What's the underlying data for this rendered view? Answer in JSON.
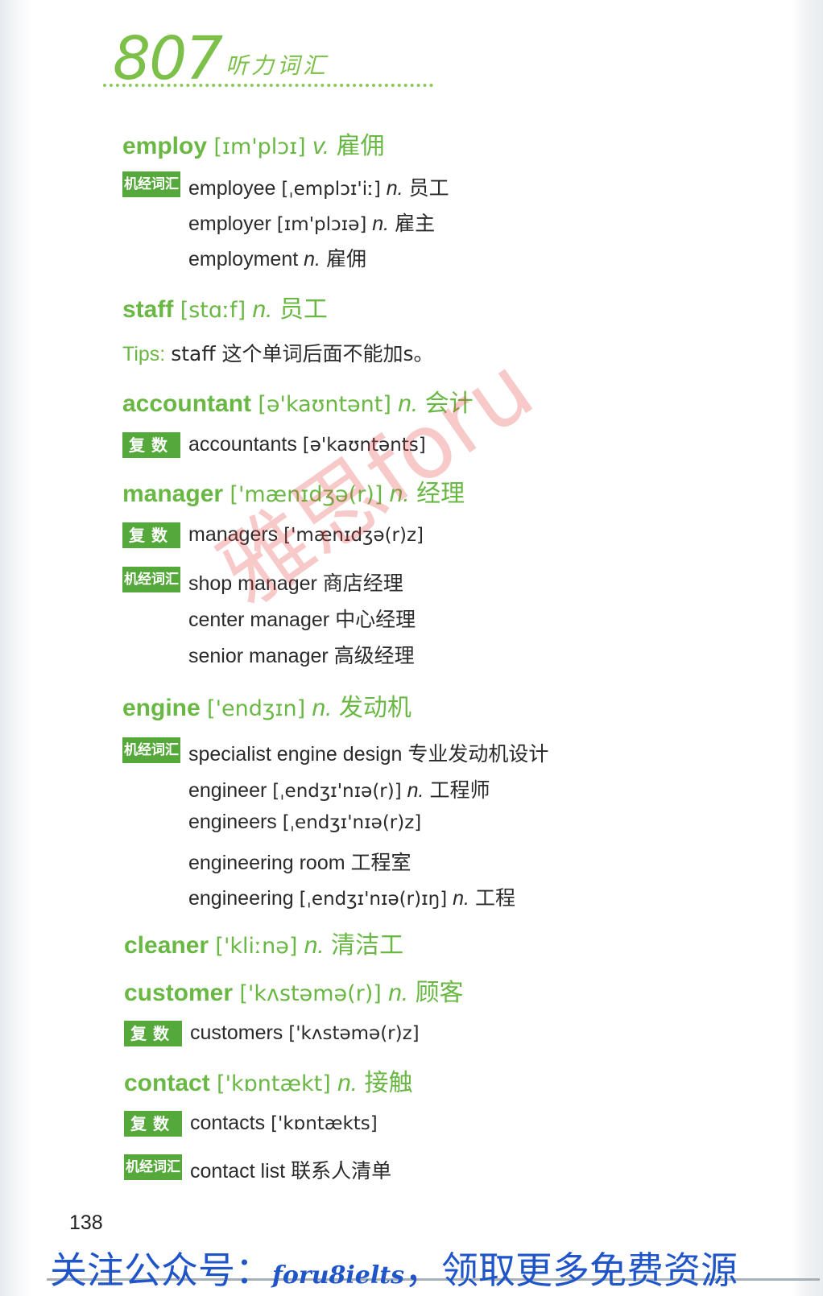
{
  "header": {
    "number": "807",
    "subtitle": "听力词汇"
  },
  "entries": [
    {
      "word": "employ",
      "phon": "[ɪm'plɔɪ]",
      "pos": "v.",
      "cn": "雇佣",
      "badge": "机经词汇",
      "lines": [
        {
          "en": "employee",
          "phon": "[ˌemplɔɪ'iː]",
          "pos": "n.",
          "cn": "员工"
        },
        {
          "en": "employer",
          "phon": "[ɪm'plɔɪə]",
          "pos": "n.",
          "cn": "雇主"
        },
        {
          "en": "employment",
          "phon": "",
          "pos": "n.",
          "cn": "雇佣"
        }
      ]
    },
    {
      "word": "staff",
      "phon": "[stɑːf]",
      "pos": "n.",
      "cn": "员工",
      "tips_label": "Tips:",
      "tips_text": "staff 这个单词后面不能加s。"
    },
    {
      "word": "accountant",
      "phon": "[ə'kaʊntənt]",
      "pos": "n.",
      "cn": "会计",
      "badge": "复数",
      "lines": [
        {
          "en": "accountants",
          "phon": "[ə'kaʊntənts]"
        }
      ]
    },
    {
      "word": "manager",
      "phon": "['mænɪdʒə(r)]",
      "pos": "n.",
      "cn": "经理",
      "badge": "复数",
      "lines": [
        {
          "en": "managers",
          "phon": "['mænɪdʒə(r)z]"
        }
      ],
      "badge2": "机经词汇",
      "lines2": [
        {
          "en": "shop manager",
          "cn": "商店经理"
        },
        {
          "en": "center manager",
          "cn": "中心经理"
        },
        {
          "en": "senior manager",
          "cn": "高级经理"
        }
      ]
    },
    {
      "word": "engine",
      "phon": "['endʒɪn]",
      "pos": "n.",
      "cn": "发动机",
      "badge": "机经词汇",
      "lines": [
        {
          "en": "specialist engine design",
          "cn": "专业发动机设计"
        },
        {
          "en": "engineer",
          "phon": "[ˌendʒɪ'nɪə(r)]",
          "pos": "n.",
          "cn": "工程师"
        },
        {
          "en": "engineers",
          "phon": "[ˌendʒɪ'nɪə(r)z]"
        },
        {
          "en": "engineering room",
          "cn": "工程室"
        },
        {
          "en": "engineering",
          "phon": "[ˌendʒɪ'nɪə(r)ɪŋ]",
          "pos": "n.",
          "cn": "工程"
        }
      ]
    },
    {
      "word": "cleaner",
      "phon": "['kliːnə]",
      "pos": "n.",
      "cn": "清洁工"
    },
    {
      "word": "customer",
      "phon": "['kʌstəmə(r)]",
      "pos": "n.",
      "cn": "顾客",
      "badge": "复数",
      "lines": [
        {
          "en": "customers",
          "phon": "['kʌstəmə(r)z]"
        }
      ]
    },
    {
      "word": "contact",
      "phon": "['kɒntækt]",
      "pos": "n.",
      "cn": "接触",
      "badge": "复数",
      "lines": [
        {
          "en": "contacts",
          "phon": "['kɒntækts]"
        }
      ],
      "badge2": "机经词汇",
      "lines2": [
        {
          "en": "contact list",
          "cn": "联系人清单"
        }
      ]
    }
  ],
  "watermark": "雅思foru",
  "page_number": "138",
  "footer": {
    "part1": "关注公众号：",
    "account": "foru8ielts",
    "part2": "，领取更多免费资源"
  }
}
